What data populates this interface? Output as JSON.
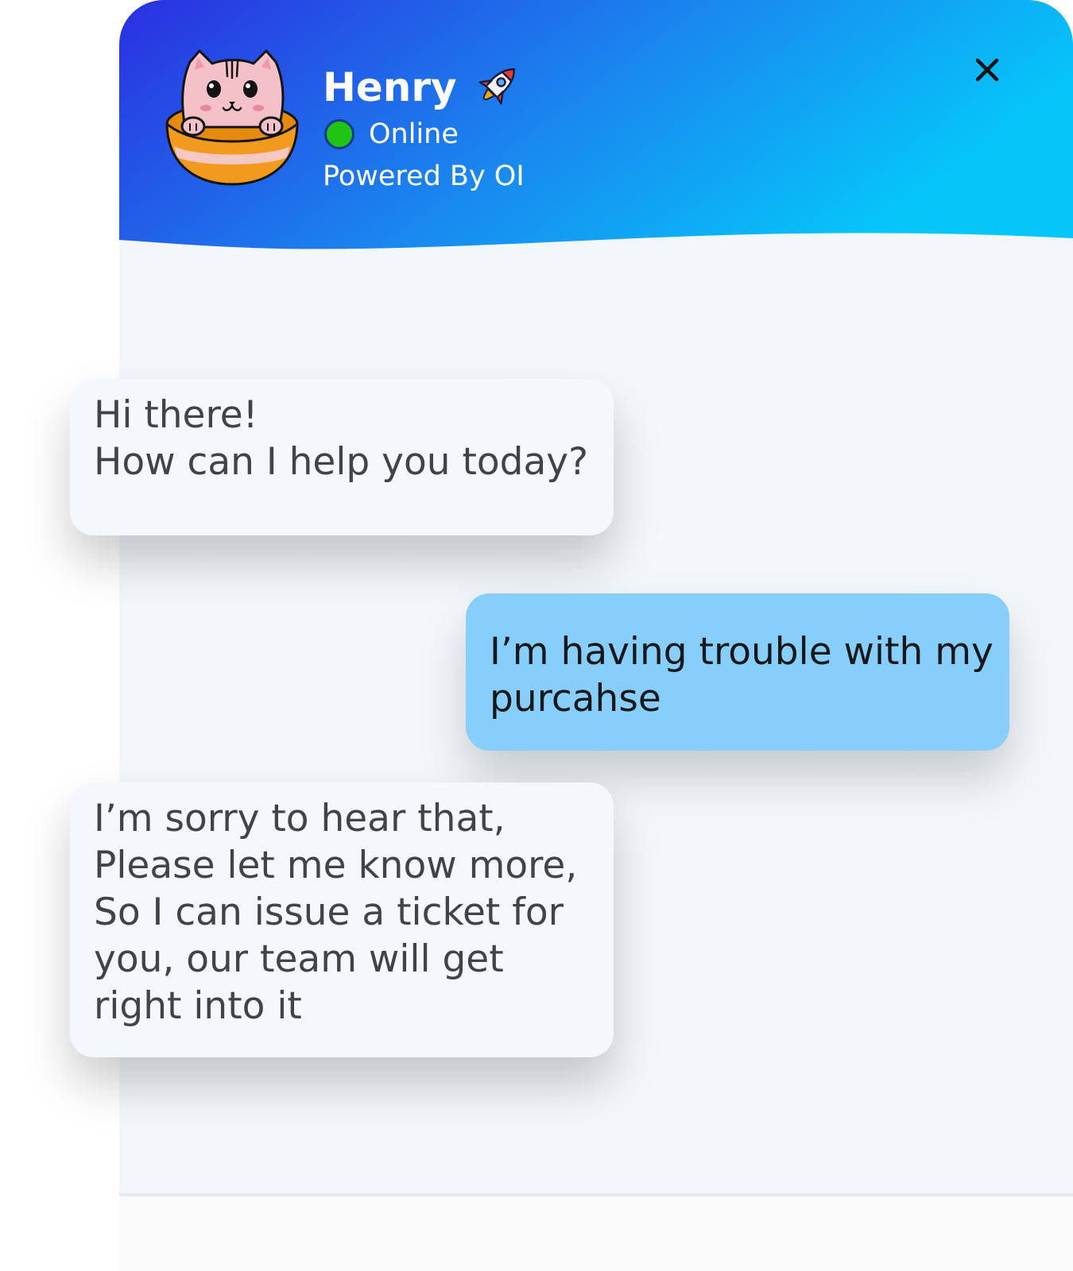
{
  "header": {
    "agent_name": "Henry",
    "status": "Online",
    "powered_by": "Powered By OI",
    "status_color": "#22c414",
    "gradient_colors": [
      "#2b2fe0",
      "#1a86ef",
      "#06c6f9"
    ],
    "icons": [
      "cat-in-bowl-avatar",
      "rocket-icon",
      "close-icon"
    ]
  },
  "messages": [
    {
      "sender": "bot",
      "text": "Hi there!\nHow can I help you today?"
    },
    {
      "sender": "user",
      "text": "I’m having trouble with my\npurcahse"
    },
    {
      "sender": "bot",
      "text": "I’m sorry to hear that,\nPlease let me know more,\nSo I can issue a ticket for\nyou, our team will get\n right into it"
    }
  ],
  "colors": {
    "bot_bubble": "#f4f8fb",
    "user_bubble": "#87cefc",
    "chat_background": "#f3f7fa"
  }
}
